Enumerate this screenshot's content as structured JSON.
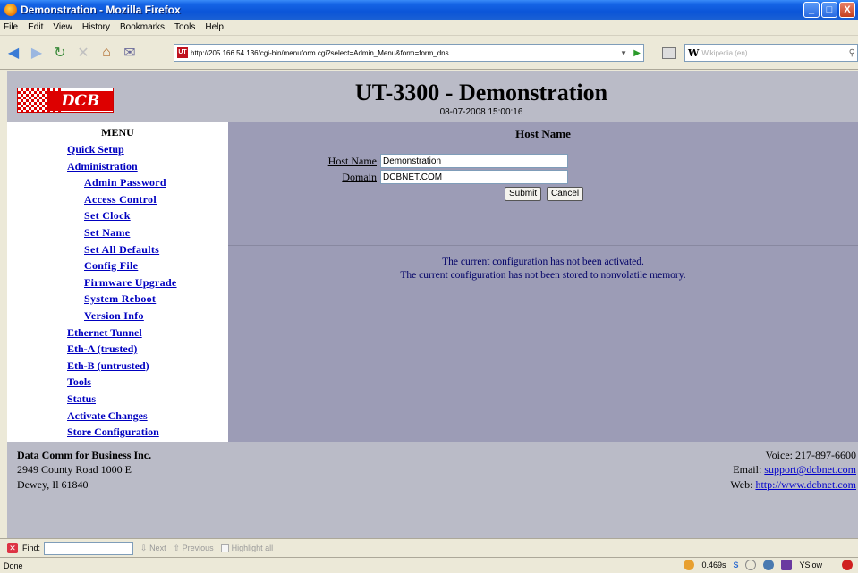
{
  "window": {
    "title": "Demonstration - Mozilla Firefox",
    "controls": [
      "_",
      "□",
      "X"
    ]
  },
  "menubar": {
    "items": [
      "File",
      "Edit",
      "View",
      "History",
      "Bookmarks",
      "Tools",
      "Help"
    ]
  },
  "navbar": {
    "url": "http://205.166.54.136/cgi-bin/menuform.cgi?select=Admin_Menu&form=form_dns",
    "favicon_text": "UT",
    "search_engine_letter": "W",
    "search_placeholder": "Wikipedia (en)"
  },
  "header": {
    "logo_text": "DCB",
    "title": "UT-3300 - Demonstration",
    "datetime": "08-07-2008 15:00:16"
  },
  "sidebar": {
    "heading": "MENU",
    "items": [
      {
        "label": "Quick Setup",
        "level": 1
      },
      {
        "label": "Administration",
        "level": 1
      },
      {
        "label": "Admin Password",
        "level": 2
      },
      {
        "label": "Access Control",
        "level": 2
      },
      {
        "label": "Set Clock",
        "level": 2
      },
      {
        "label": "Set Name",
        "level": 2
      },
      {
        "label": "Set All Defaults",
        "level": 2
      },
      {
        "label": "Config File",
        "level": 2
      },
      {
        "label": "Firmware Upgrade",
        "level": 2
      },
      {
        "label": "System Reboot",
        "level": 2
      },
      {
        "label": "Version Info",
        "level": 2
      },
      {
        "label": "Ethernet Tunnel",
        "level": 1
      },
      {
        "label": "Eth-A (trusted)",
        "level": 1
      },
      {
        "label": "Eth-B (untrusted)",
        "level": 1
      },
      {
        "label": "Tools",
        "level": 1
      },
      {
        "label": "Status",
        "level": 1
      },
      {
        "label": "Activate Changes",
        "level": 1
      },
      {
        "label": "Store Configuration",
        "level": 1
      }
    ]
  },
  "main": {
    "section_title": "Host Name",
    "host_name_label": "Host Name",
    "host_name_value": "Demonstration",
    "domain_label": "Domain",
    "domain_value": "DCBNET.COM",
    "submit_label": "Submit",
    "cancel_label": "Cancel",
    "notice_1": "The current configuration has not been activated.",
    "notice_2": "The current configuration has not been stored to nonvolatile memory."
  },
  "footer": {
    "company": "Data Comm for Business Inc.",
    "address_line1": "2949 County Road 1000 E",
    "address_line2": "Dewey, Il 61840",
    "voice_label": "Voice:",
    "voice": "217-897-6600",
    "email_label": "Email:",
    "email": "support@dcbnet.com",
    "web_label": "Web:",
    "web": "http://www.dcbnet.com"
  },
  "findbar": {
    "label": "Find:",
    "next": "Next",
    "previous": "Previous",
    "highlight": "Highlight all"
  },
  "statusbar": {
    "status": "Done",
    "timing": "0.469s",
    "yslow": "YSlow"
  }
}
